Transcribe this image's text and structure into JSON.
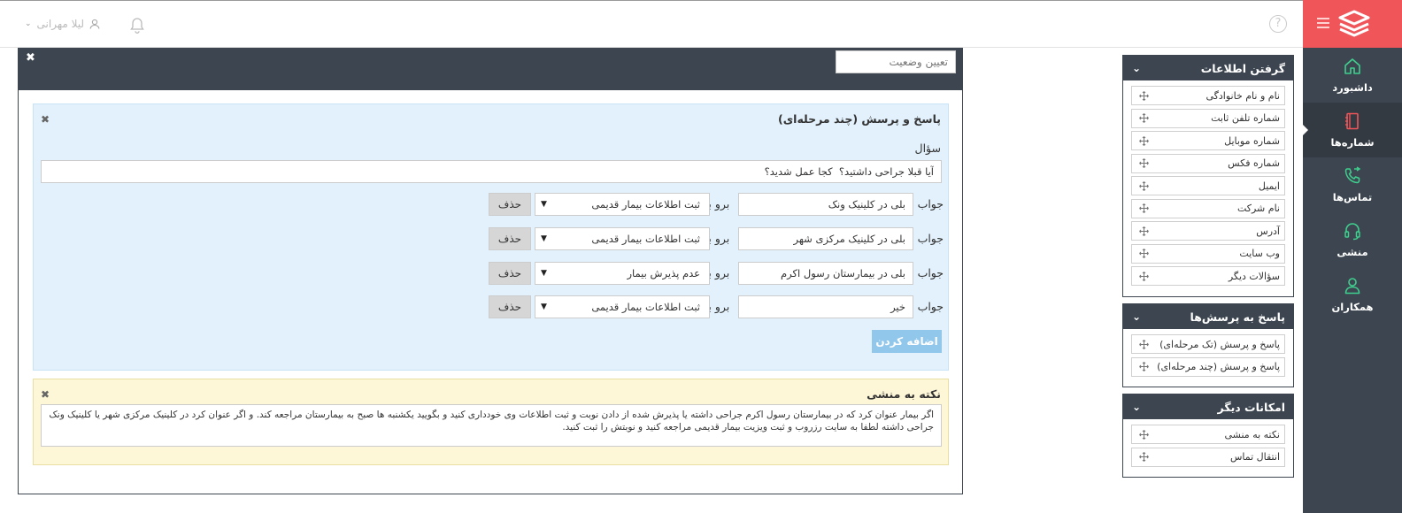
{
  "header": {
    "user_name": "لیلا مهرانی",
    "help_symbol": "?"
  },
  "nav": {
    "items": [
      {
        "label": "داشبورد",
        "icon": "home-icon"
      },
      {
        "label": "شماره‌ها",
        "icon": "phonebook-icon"
      },
      {
        "label": "تماس‌ها",
        "icon": "phone-call-icon"
      },
      {
        "label": "منشی",
        "icon": "headset-icon"
      },
      {
        "label": "همکاران",
        "icon": "users-icon"
      }
    ],
    "active_index": 1,
    "brand_color": "#f0555a",
    "nav_color": "#3d4650"
  },
  "panels": [
    {
      "title": "گرفتن اطلاعات",
      "items": [
        "نام و نام خانوادگی",
        "شماره تلفن ثابت",
        "شماره موبایل",
        "شماره فکس",
        "ایمیل",
        "نام شرکت",
        "آدرس",
        "وب سایت",
        "سؤالات دیگر"
      ]
    },
    {
      "title": "پاسخ به پرسش‌ها",
      "items": [
        "پاسخ و پرسش (تک مرحله‌ای)",
        "پاسخ و پرسش (چند مرحله‌ای)"
      ]
    },
    {
      "title": "امکانات دیگر",
      "items": [
        "نکته به منشی",
        "انتقال تماس"
      ]
    }
  ],
  "editor": {
    "close_symbol": "✖",
    "status_placeholder": "تعیین وضعیت",
    "qa": {
      "title": "پاسخ و پرسش (چند مرحله‌ای)",
      "question_label": "سؤال",
      "question_value": "آیا قبلا جراحی داشتید؟  کجا عمل شدید؟",
      "answer_label": "جواب",
      "goto_label": "برو به",
      "delete_label": "حذف",
      "answers": [
        {
          "answer": "بلی در کلینیک ونک",
          "goto": "ثبت اطلاعات بیمار قدیمی"
        },
        {
          "answer": "بلی در کلینیک مرکزی شهر",
          "goto": "ثبت اطلاعات بیمار قدیمی"
        },
        {
          "answer": "بلی در بیمارستان رسول اکرم",
          "goto": "عدم پذیرش بیمار"
        },
        {
          "answer": "خیر",
          "goto": "ثبت اطلاعات بیمار قدیمی"
        }
      ],
      "add_label": "اضافه کردن"
    },
    "note": {
      "title": "نکته به منشی",
      "text": "اگر بیمار عنوان کرد که در بیمارستان رسول اکرم جراحی داشته یا پذیرش شده از دادن نوبت و ثبت اطلاعات وی خودداری کنید و بگویید یکشنبه ها صبح به بیمارستان مراجعه کند. و اگر عنوان کرد در کلینیک مرکزی شهر یا کلینیک ونک جراحی داشته لطفا به سایت رزروب و ثبت ویزیت بیمار قدیمی مراجعه کنید و نوبتش را ثبت کنید."
    }
  }
}
